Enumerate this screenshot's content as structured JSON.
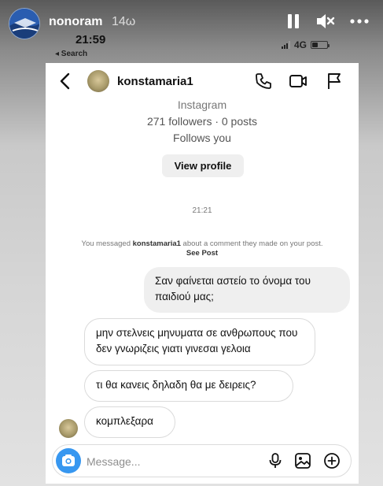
{
  "story": {
    "username": "nonoram",
    "time_ago": "14ω"
  },
  "status_bar": {
    "time": "21:59",
    "back_label": "◂ Search",
    "network": "4G"
  },
  "chat_header": {
    "name": "konstamaria1"
  },
  "profile_card": {
    "platform": "Instagram",
    "stats": "271 followers · 0 posts",
    "relation": "Follows you",
    "view_profile_label": "View profile"
  },
  "timestamp": "21:21",
  "notice": {
    "prefix": "You messaged ",
    "user": "konstamaria1",
    "middle": " about a comment they made on your post. ",
    "link": "See Post"
  },
  "messages": [
    {
      "direction": "outgoing",
      "text": "Σαν φαίνεται αστείο το όνομα του παιδιού μας;"
    },
    {
      "direction": "incoming",
      "text": "μην στελνεις μηνυματα σε ανθρωπους που δεν γνωριζεις  γιατι γινεσαι γελοια"
    },
    {
      "direction": "incoming",
      "text": "τι θα κανεις δηλαδη θα με δειρεις?"
    },
    {
      "direction": "incoming",
      "text": "κομπλεξαρα"
    }
  ],
  "composer": {
    "placeholder": "Message..."
  },
  "colors": {
    "accent": "#3797f0",
    "bubble_out": "#efefef",
    "bubble_in_border": "#dadada"
  },
  "icons": {
    "pause": "pause-icon",
    "mute": "speaker-muted-icon",
    "more": "more-horizontal-icon",
    "call": "phone-icon",
    "video": "video-camera-icon",
    "report": "flag-icon",
    "camera": "camera-icon",
    "mic": "microphone-icon",
    "gallery": "image-icon",
    "add": "plus-circle-icon"
  }
}
